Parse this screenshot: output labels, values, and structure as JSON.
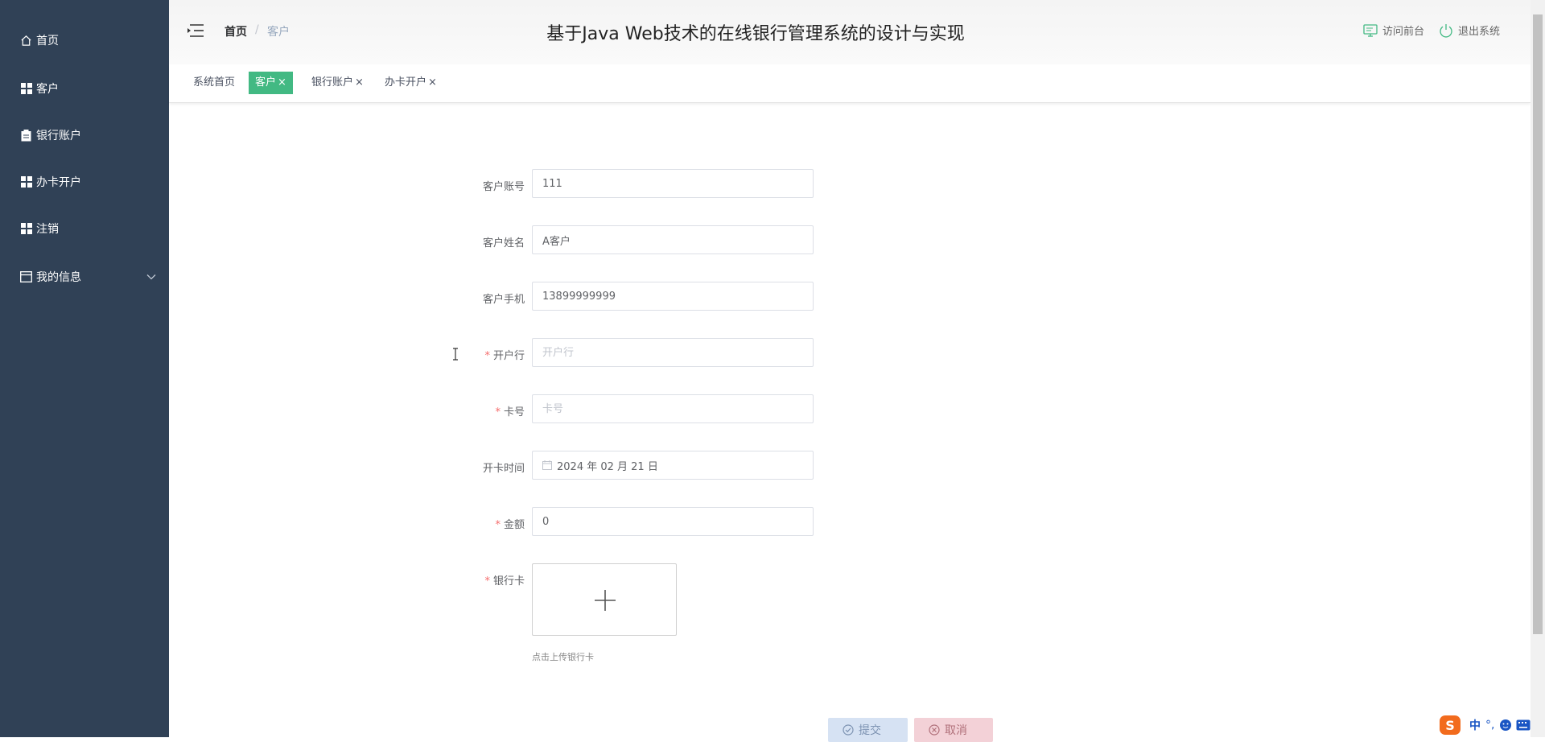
{
  "sidebar": {
    "items": [
      {
        "label": "首页",
        "icon": "home-icon"
      },
      {
        "label": "客户",
        "icon": "grid-icon"
      },
      {
        "label": "银行账户",
        "icon": "clipboard-icon"
      },
      {
        "label": "办卡开户",
        "icon": "grid-icon"
      },
      {
        "label": "注销",
        "icon": "grid-icon"
      },
      {
        "label": "我的信息",
        "icon": "window-icon",
        "expandable": true
      }
    ]
  },
  "header": {
    "breadcrumb": {
      "home": "首页",
      "separator": "/",
      "current": "客户"
    },
    "title": "基于Java Web技术的在线银行管理系统的设计与实现",
    "visit_front": "访问前台",
    "logout": "退出系统"
  },
  "tags": [
    {
      "label": "系统首页",
      "active": false,
      "closable": false
    },
    {
      "label": "客户",
      "active": true,
      "closable": true
    },
    {
      "label": "银行账户",
      "active": false,
      "closable": true
    },
    {
      "label": "办卡开户",
      "active": false,
      "closable": true
    }
  ],
  "tag_close": "×",
  "form": {
    "account": {
      "label": "客户账号",
      "value": "111"
    },
    "name": {
      "label": "客户姓名",
      "value": "A客户"
    },
    "phone": {
      "label": "客户手机",
      "value": "13899999999"
    },
    "bank": {
      "label": "开户行",
      "placeholder": "开户行",
      "required": true
    },
    "card": {
      "label": "卡号",
      "placeholder": "卡号",
      "required": true
    },
    "open_date": {
      "label": "开卡时间",
      "value": "2024 年 02 月 21 日"
    },
    "amount": {
      "label": "金额",
      "value": "0",
      "required": true
    },
    "bank_card": {
      "label": "银行卡",
      "required": true,
      "hint": "点击上传银行卡"
    },
    "required_mark": "*"
  },
  "buttons": {
    "submit": "提交",
    "cancel": "取消"
  },
  "ime": {
    "lang": "中",
    "punct": "°,"
  },
  "colors": {
    "sidebar_bg": "#304156",
    "accent": "#42b983",
    "required": "#f56c6c"
  }
}
